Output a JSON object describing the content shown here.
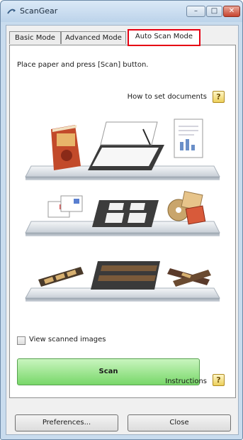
{
  "window": {
    "title": "ScanGear"
  },
  "title_buttons": {
    "minimize": "–",
    "maximize": "□",
    "close": "✕"
  },
  "tabs": [
    {
      "label": "Basic Mode",
      "selected": false
    },
    {
      "label": "Advanced Mode",
      "selected": false
    },
    {
      "label": "Auto Scan Mode",
      "selected": true,
      "highlight_color": "#e60012"
    }
  ],
  "auto_scan": {
    "instruction": "Place paper and press [Scan] button.",
    "how_to_label": "How to set documents",
    "help_glyph": "?",
    "shelves": [
      {
        "items": [
          "magazine",
          "flatbed-scanner-open",
          "document-page"
        ]
      },
      {
        "items": [
          "postcards",
          "photos-on-glass",
          "disc-and-photos"
        ]
      },
      {
        "items": [
          "film-strip",
          "film-holder",
          "slide-strips"
        ]
      }
    ],
    "view_scanned_images": {
      "label": "View scanned images",
      "checked": false
    },
    "scan_button": "Scan",
    "instructions_label": "Instructions"
  },
  "footer": {
    "preferences": "Preferences...",
    "close": "Close"
  },
  "colors": {
    "accent_red": "#e60012",
    "scan_green": "#78d769",
    "titlebar": "#bcd3ea"
  },
  "icons": [
    "scangear-app-icon",
    "help-icon",
    "checkbox-icon"
  ]
}
